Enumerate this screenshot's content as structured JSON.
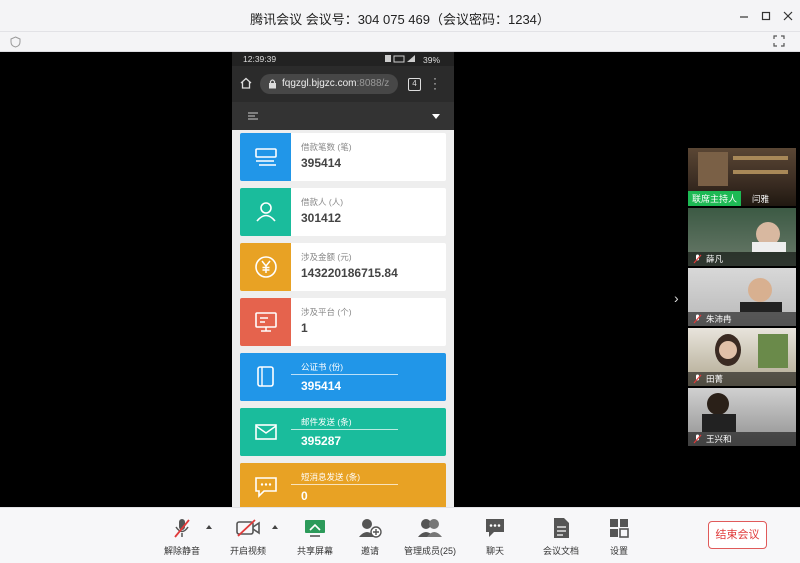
{
  "window": {
    "title": "腾讯会议 会议号：304 075 469（会议密码：1234）"
  },
  "phone": {
    "status_time": "12:39:39",
    "status_right": "39%",
    "url_main": "fqgzgl.bjgzc.com",
    "url_dim": ":8088/z",
    "tab_count": "4"
  },
  "cards": [
    {
      "label": "借款笔数 (笔)",
      "value": "395414",
      "color": "#2196e8",
      "icon": "loan-count-icon"
    },
    {
      "label": "借款人 (人)",
      "value": "301412",
      "color": "#1abc9c",
      "icon": "borrowers-icon"
    },
    {
      "label": "涉及金额 (元)",
      "value": "143220186715.84",
      "color": "#e8a224",
      "icon": "yen-icon"
    },
    {
      "label": "涉及平台 (个)",
      "value": "1",
      "color": "#e5634d",
      "icon": "platform-icon"
    },
    {
      "label": "公证书 (份)",
      "value": "395414",
      "color": "#2196e8",
      "icon": "notary-icon"
    },
    {
      "label": "邮件发送 (条)",
      "value": "395287",
      "color": "#1abc9c",
      "icon": "mail-icon"
    },
    {
      "label": "短消息发送 (条)",
      "value": "0",
      "color": "#e8a224",
      "icon": "sms-icon"
    }
  ],
  "participants": {
    "host_tag": "联席主持人",
    "host_name": "闫雅",
    "list": [
      {
        "name": "薛凡"
      },
      {
        "name": "朱沛冉"
      },
      {
        "name": "田菁"
      },
      {
        "name": "王兴和"
      }
    ]
  },
  "toolbar": {
    "unmute": "解除静音",
    "start_video": "开启视频",
    "share_screen": "共享屏幕",
    "invite": "邀请",
    "manage_members": "管理成员(25)",
    "chat": "聊天",
    "docs": "会议文档",
    "settings": "设置",
    "end_meeting": "结束会议"
  }
}
